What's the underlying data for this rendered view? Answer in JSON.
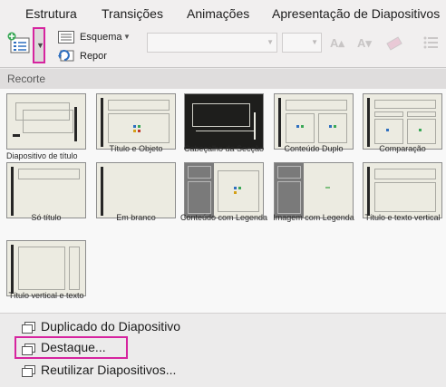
{
  "ribbon": {
    "tabs": [
      "Estrutura",
      "Transições",
      "Animações",
      "Apresentação de Diapositivos"
    ],
    "layout_label": "Esquema",
    "reset_label": "Repor"
  },
  "gallery": {
    "section_title": "Recorte",
    "layouts": [
      {
        "label": "Diapositivo de título"
      },
      {
        "label": "Título e Objeto"
      },
      {
        "label": "Cabeçalho da Secção"
      },
      {
        "label": "Conteúdo Duplo"
      },
      {
        "label": "Comparação"
      },
      {
        "label": "Só título"
      },
      {
        "label": "Em branco"
      },
      {
        "label": "Conteúdo com Legenda"
      },
      {
        "label": "Imagem com Legenda"
      },
      {
        "label": "Título e texto vertical"
      },
      {
        "label": "Título vertical e texto"
      }
    ]
  },
  "menu": {
    "duplicate": "Duplicado do Diapositivo",
    "outline": "Destaque...",
    "reuse": "Reutilizar Diapositivos..."
  },
  "colors": {
    "highlight": "#d6249f",
    "accent_blue": "#2f6fbf",
    "accent_green": "#3aa857"
  }
}
